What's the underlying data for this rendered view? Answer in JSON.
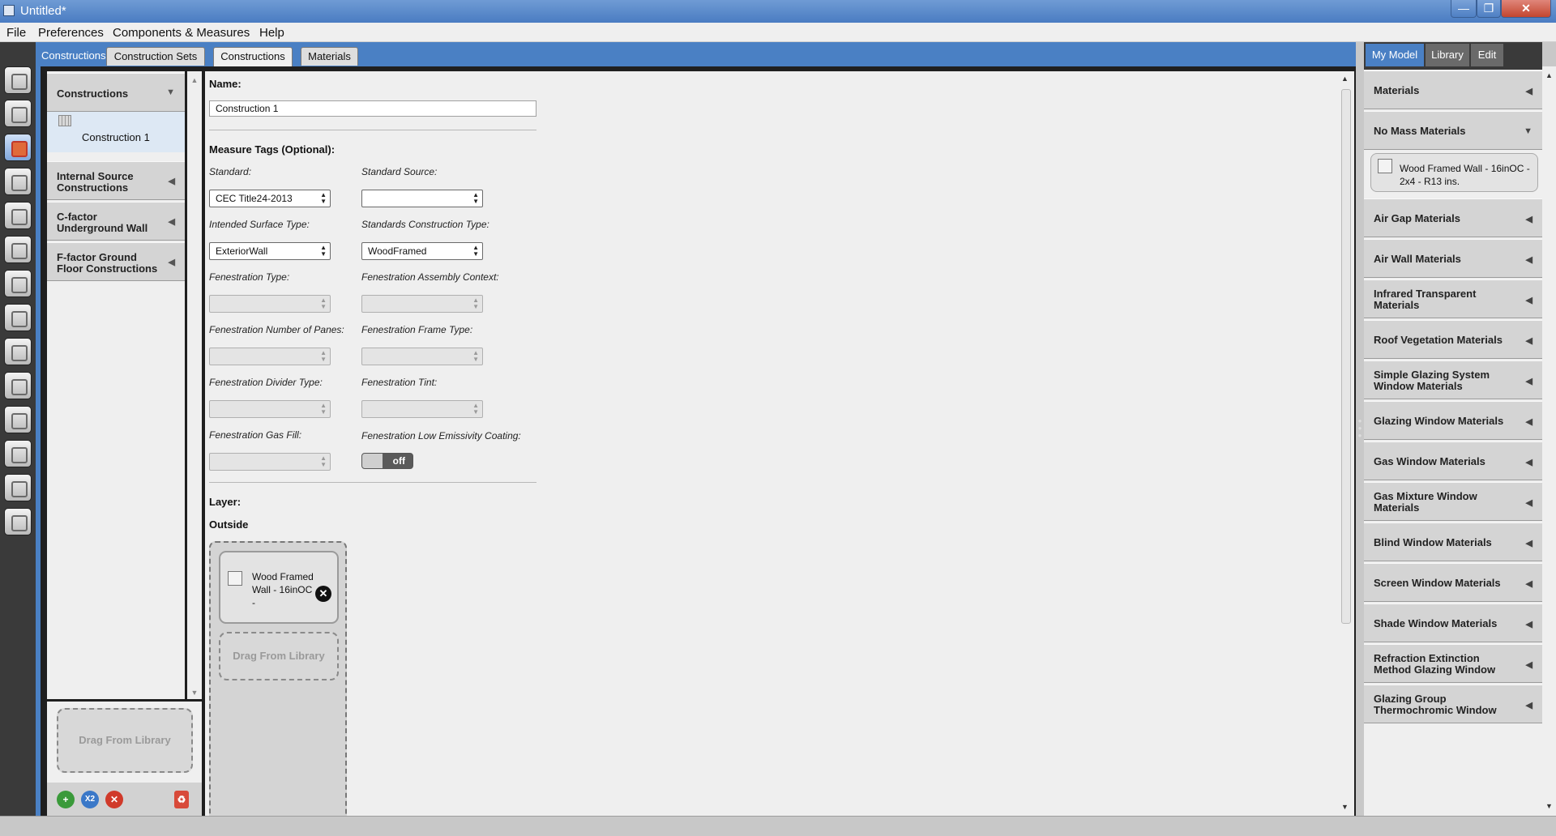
{
  "window": {
    "title": "Untitled*"
  },
  "menu": [
    "File",
    "Preferences",
    "Components & Measures",
    "Help"
  ],
  "subtabs": {
    "current": "Constructions",
    "tabs": [
      "Construction Sets",
      "Constructions",
      "Materials"
    ]
  },
  "left_panel": {
    "headers": [
      "Constructions",
      "Internal Source Constructions",
      "C-factor Underground Wall",
      "F-factor Ground Floor Constructions"
    ],
    "items": [
      "Construction 1"
    ],
    "drop_label": "Drag From Library",
    "buttons": {
      "copy_label": "X2"
    }
  },
  "form": {
    "name_label": "Name:",
    "name_value": "Construction 1",
    "measure_tags_label": "Measure Tags (Optional):",
    "standard_label": "Standard:",
    "standard_value": "CEC Title24-2013",
    "standard_source_label": "Standard Source:",
    "standard_source_value": "",
    "intended_surface_label": "Intended Surface Type:",
    "intended_surface_value": "ExteriorWall",
    "standards_construction_label": "Standards Construction Type:",
    "standards_construction_value": "WoodFramed",
    "fen_type_label": "Fenestration Type:",
    "fen_assembly_label": "Fenestration Assembly Context:",
    "fen_panes_label": "Fenestration Number of Panes:",
    "fen_frame_label": "Fenestration Frame Type:",
    "fen_divider_label": "Fenestration Divider Type:",
    "fen_tint_label": "Fenestration Tint:",
    "fen_gas_label": "Fenestration Gas Fill:",
    "fen_lowe_label": "Fenestration Low Emissivity Coating:",
    "lowe_toggle": "off",
    "layer_label": "Layer:",
    "outside_label": "Outside",
    "layer_card_text": "Wood Framed Wall - 16inOC -",
    "layer_drop_label": "Drag From Library"
  },
  "right_panel": {
    "tabs": [
      "My Model",
      "Library",
      "Edit"
    ],
    "headers": [
      "Materials",
      "No Mass Materials",
      "Air Gap Materials",
      "Air Wall Materials",
      "Infrared Transparent Materials",
      "Roof Vegetation Materials",
      "Simple Glazing System Window Materials",
      "Glazing Window Materials",
      "Gas Window Materials",
      "Gas Mixture Window Materials",
      "Blind Window Materials",
      "Screen Window Materials",
      "Shade Window Materials",
      "Refraction Extinction Method Glazing Window",
      "Glazing Group Thermochromic Window"
    ],
    "no_mass_item": "Wood Framed Wall - 16inOC - 2x4 - R13 ins."
  },
  "colors": {
    "accent_blue": "#4a80c4",
    "toolbar_dark": "#3a3a3a",
    "panel_gray": "#efefef"
  },
  "icons": [
    "site-icon",
    "schedules-icon",
    "constructions-icon",
    "loads-icon",
    "space-types-icon",
    "facility-icon",
    "spaces-icon",
    "thermal-zones-icon",
    "hvac-icon",
    "output-variables-icon",
    "simulation-settings-icon",
    "measures-icon",
    "run-icon",
    "results-icon"
  ]
}
